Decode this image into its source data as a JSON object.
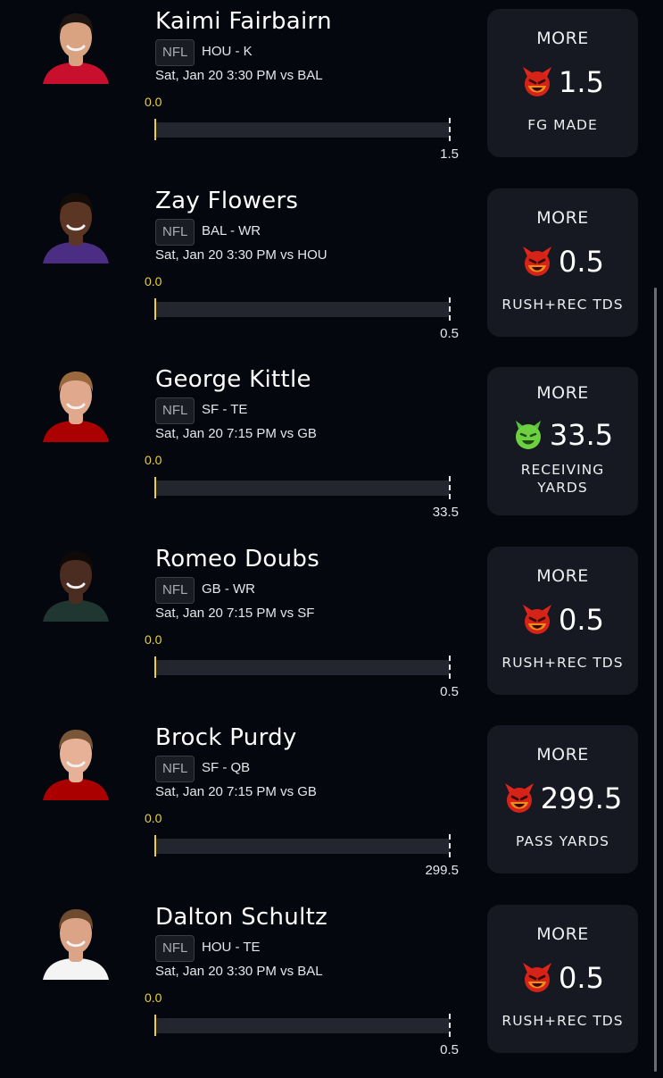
{
  "league_label": "NFL",
  "more_label": "MORE",
  "players": [
    {
      "name": "Kaimi Fairbairn",
      "team_pos": "HOU - K",
      "game": "Sat, Jan 20 3:30 PM  vs BAL",
      "current": "0.0",
      "line": "1.5",
      "stat": "FG MADE",
      "icon": "red-devil-icon",
      "jersey_color": "#c8102e",
      "skin": "#d9a382",
      "hair": "#1d1612"
    },
    {
      "name": "Zay Flowers",
      "team_pos": "BAL - WR",
      "game": "Sat, Jan 20 3:30 PM  vs HOU",
      "current": "0.0",
      "line": "0.5",
      "stat": "RUSH+REC TDS",
      "icon": "red-devil-icon",
      "jersey_color": "#4b2e83",
      "skin": "#5b3625",
      "hair": "#120c09"
    },
    {
      "name": "George Kittle",
      "team_pos": "SF - TE",
      "game": "Sat, Jan 20 7:15 PM  vs GB",
      "current": "0.0",
      "line": "33.5",
      "stat": "RECEIVING YARDS",
      "icon": "green-goblin-icon",
      "jersey_color": "#aa0000",
      "skin": "#e0a98e",
      "hair": "#9a6a3e"
    },
    {
      "name": "Romeo Doubs",
      "team_pos": "GB - WR",
      "game": "Sat, Jan 20 7:15 PM  vs SF",
      "current": "0.0",
      "line": "0.5",
      "stat": "RUSH+REC TDS",
      "icon": "red-devil-icon",
      "jersey_color": "#203731",
      "skin": "#4a2c20",
      "hair": "#0f0a08"
    },
    {
      "name": "Brock Purdy",
      "team_pos": "SF - QB",
      "game": "Sat, Jan 20 7:15 PM  vs GB",
      "current": "0.0",
      "line": "299.5",
      "stat": "PASS YARDS",
      "icon": "red-devil-icon",
      "jersey_color": "#aa0000",
      "skin": "#e6b197",
      "hair": "#7a5638"
    },
    {
      "name": "Dalton Schultz",
      "team_pos": "HOU - TE",
      "game": "Sat, Jan 20 3:30 PM  vs BAL",
      "current": "0.0",
      "line": "0.5",
      "stat": "RUSH+REC TDS",
      "icon": "red-devil-icon",
      "jersey_color": "#f4f4f4",
      "skin": "#dca486",
      "hair": "#6e4a2e"
    }
  ],
  "colors": {
    "background": "#05070e",
    "card": "#161922",
    "progress_accent": "#ecd13a"
  }
}
